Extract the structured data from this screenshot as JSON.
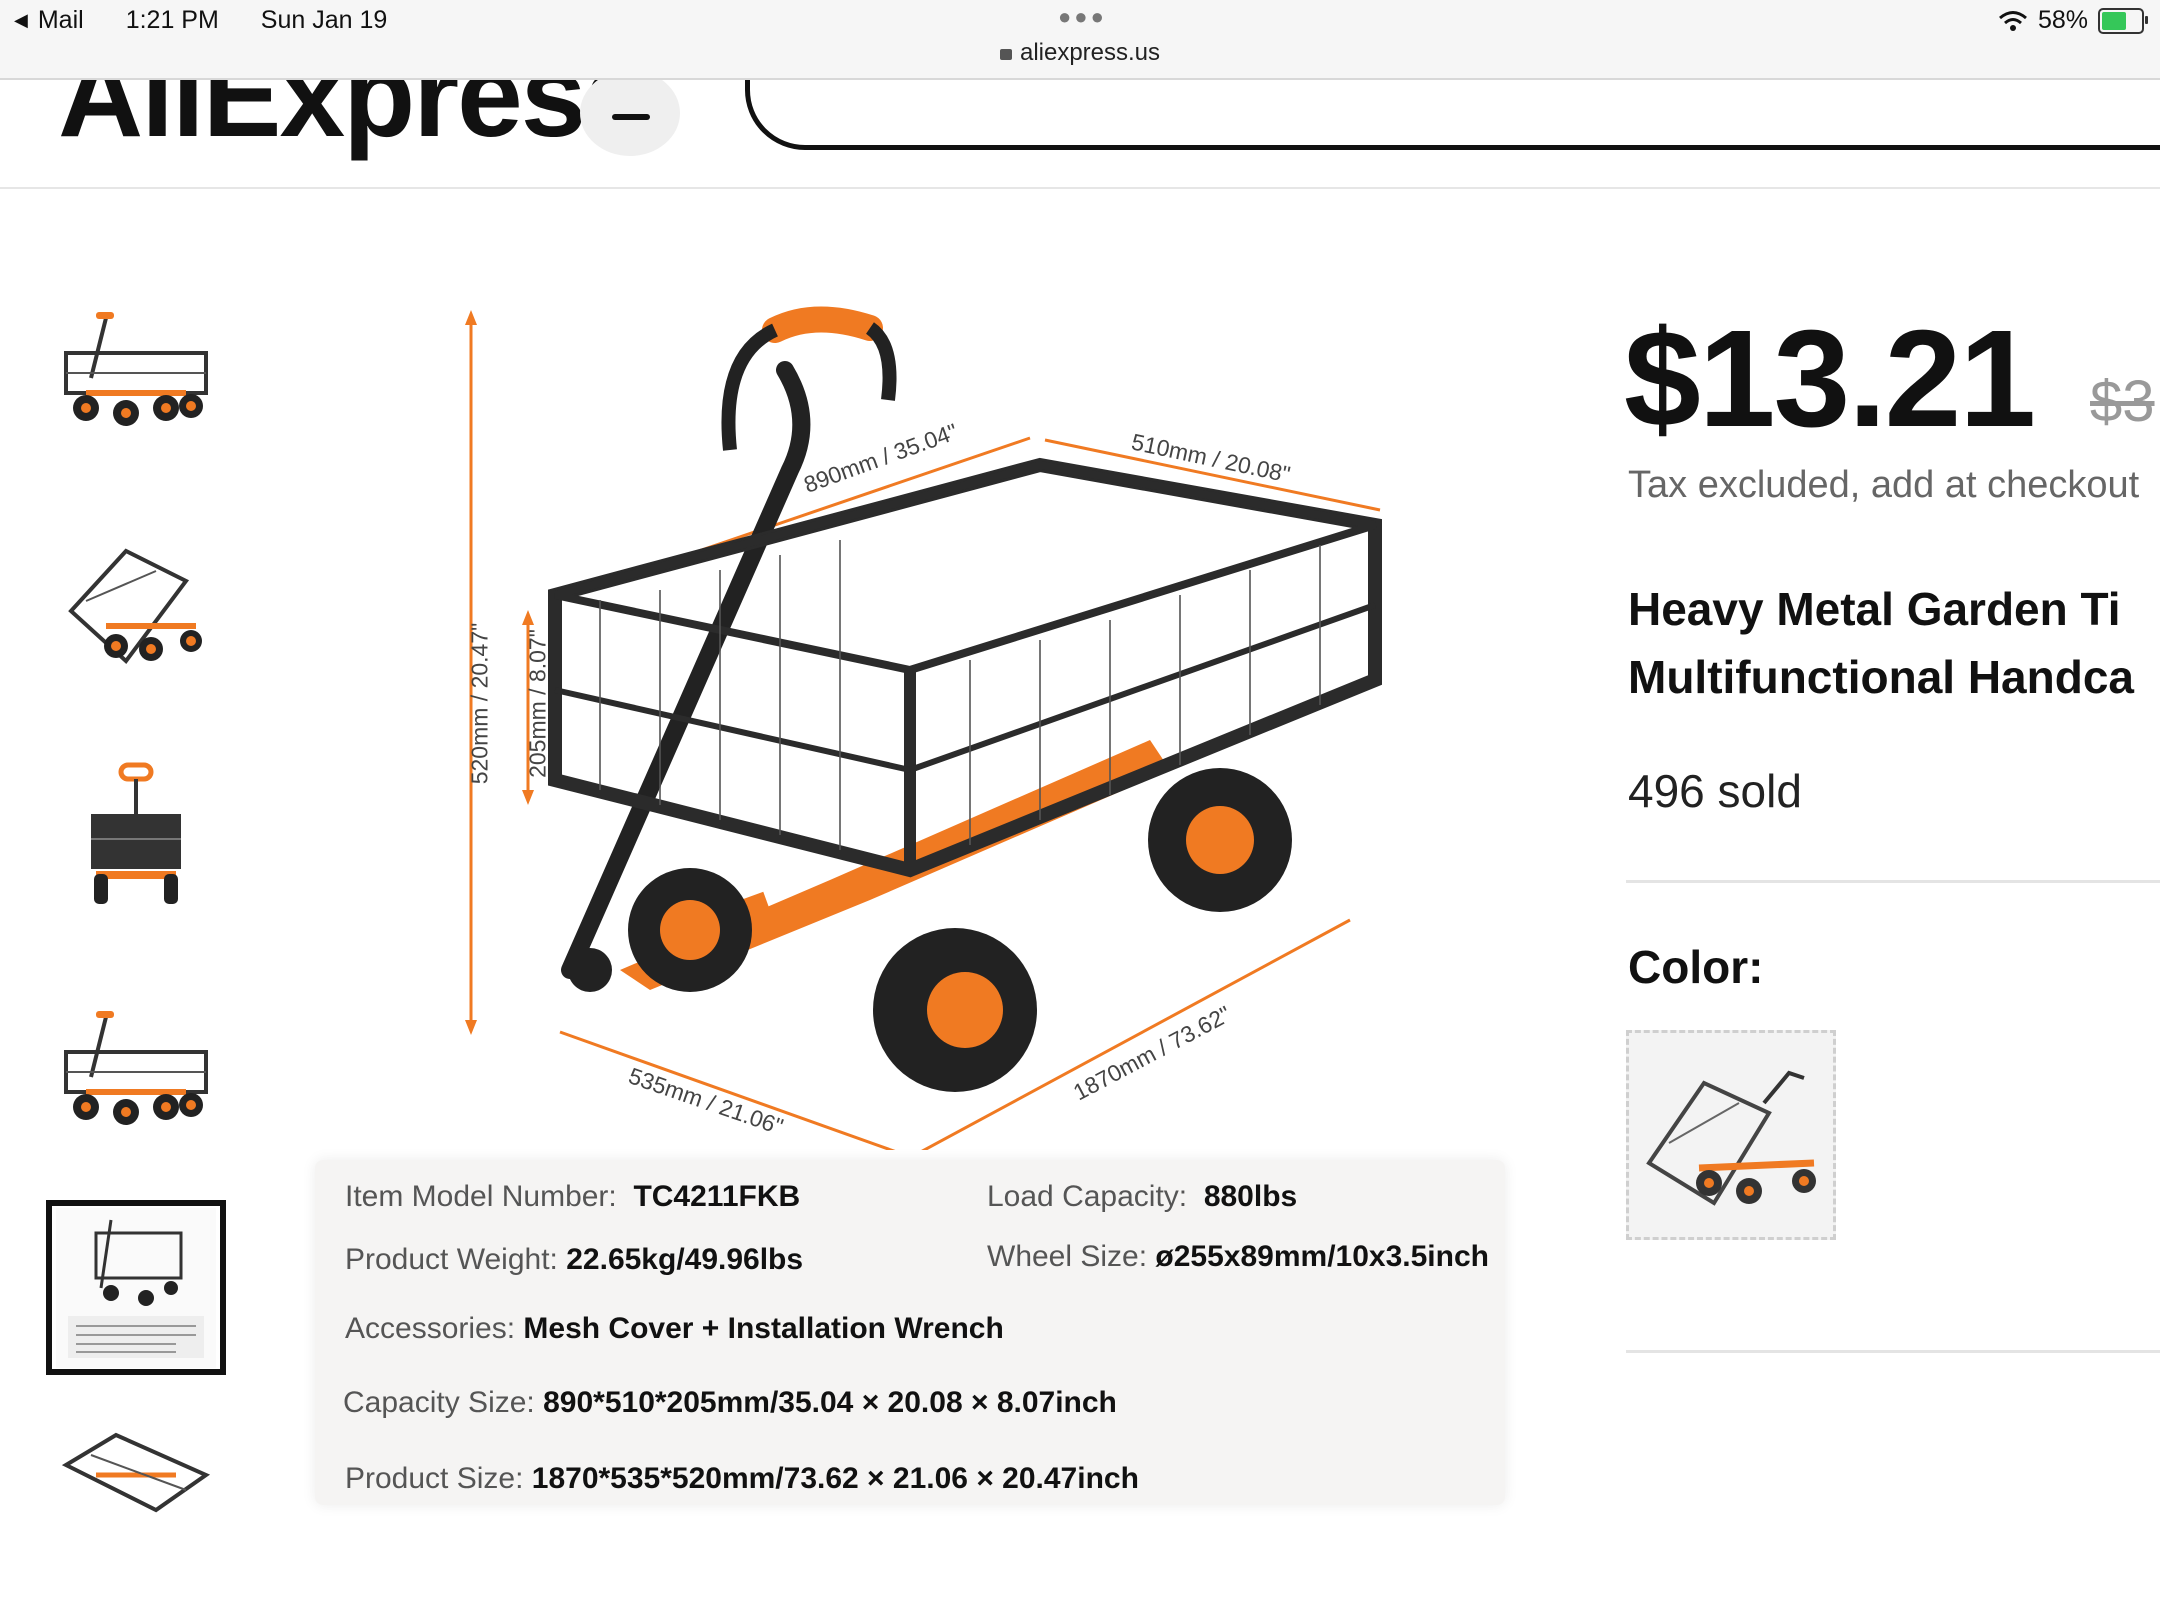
{
  "status_bar": {
    "back_app": "Mail",
    "time": "1:21 PM",
    "date": "Sun Jan 19",
    "url": "aliexpress.us",
    "battery": "58%"
  },
  "header": {
    "logo": "AliExpress"
  },
  "gallery": {
    "thumbnails": [
      "wagon-front",
      "wagon-tilted",
      "wagon-back",
      "wagon-front-2",
      "wagon-spec-sheet",
      "wagon-top"
    ],
    "active_index": 4
  },
  "main_image": {
    "dims": {
      "height_total": "520mm / 20.47\"",
      "height_box": "205mm / 8.07\"",
      "length_box": "890mm / 35.04\"",
      "width_box": "510mm / 20.08\"",
      "width_total": "535mm / 21.06\"",
      "length_total": "1870mm / 73.62\""
    },
    "specs": {
      "model_label": "Item Model Number:",
      "model_value": "TC4211FKB",
      "load_label": "Load Capacity:",
      "load_value": "880lbs",
      "weight_label": "Product Weight:",
      "weight_value": "22.65kg/49.96lbs",
      "wheel_label": "Wheel Size:",
      "wheel_value": "ø255x89mm/10x3.5inch",
      "acc_label": "Accessories:",
      "acc_value": "Mesh Cover + Installation Wrench",
      "capacity_label": "Capacity Size:",
      "capacity_value": "890*510*205mm/35.04 × 20.08 × 8.07inch",
      "size_label": "Product Size:",
      "size_value": "1870*535*520mm/73.62 × 21.06 × 20.47inch"
    }
  },
  "product": {
    "price": "$13.21",
    "old_price": "$3",
    "tax_note": "Tax excluded, add at checkout",
    "title_line1": "Heavy Metal Garden Ti",
    "title_line2": "Multifunctional Handca",
    "sold": "496 sold",
    "color_label": "Color:"
  },
  "colors": {
    "orange": "#f07a22",
    "frame": "#2b2b2b"
  }
}
